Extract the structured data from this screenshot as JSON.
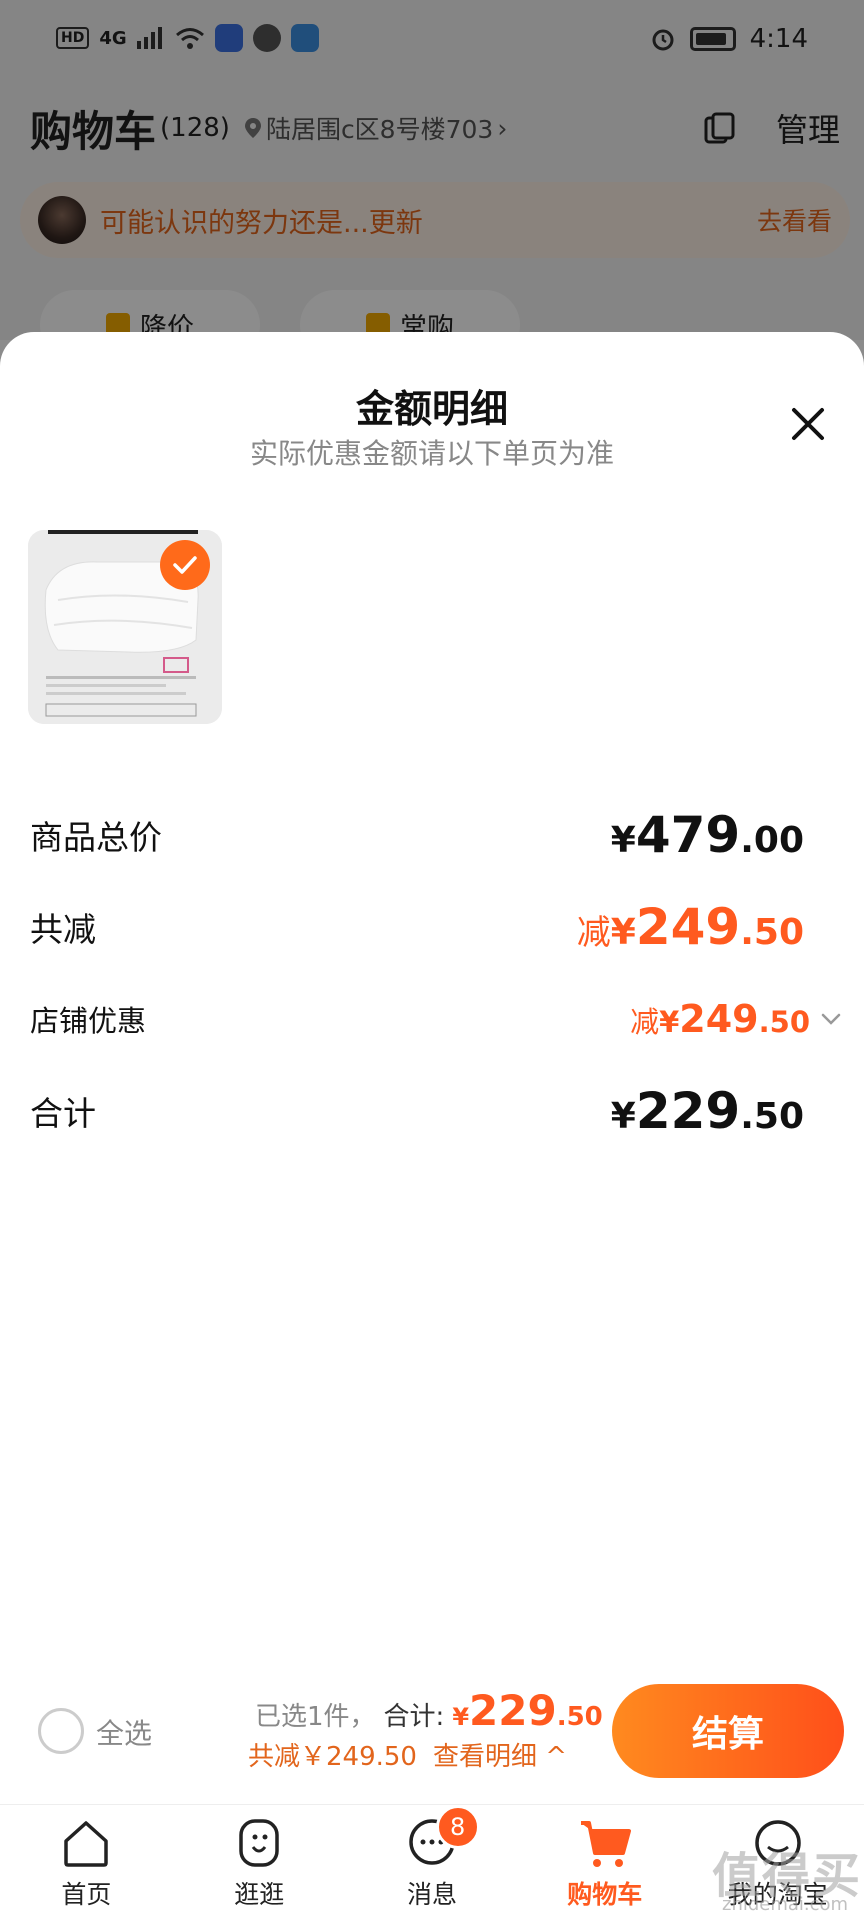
{
  "status_bar": {
    "network": "HD",
    "signal": "4G",
    "time": "4:14"
  },
  "cart_header": {
    "title": "购物车",
    "count": "(128)",
    "address": "陆居围c区8号楼703",
    "manage_label": "管理"
  },
  "notice": {
    "text": "可能认识的努力还是...更新",
    "link": "去看看"
  },
  "chips": [
    {
      "label": "降价"
    },
    {
      "label": "常购"
    }
  ],
  "sheet": {
    "title": "金额明细",
    "subtitle": "实际优惠金额请以下单页为准",
    "rows": {
      "total": {
        "label": "商品总价",
        "symbol": "¥",
        "int": "479",
        "dec": ".00"
      },
      "reduce": {
        "label": "共减",
        "prefix": "减",
        "symbol": "¥",
        "int": "249",
        "dec": ".50"
      },
      "shop_discount": {
        "label": "店铺优惠",
        "prefix": "减",
        "symbol": "¥",
        "int": "249",
        "dec": ".50"
      },
      "sum": {
        "label": "合计",
        "symbol": "¥",
        "int": "229",
        "dec": ".50"
      }
    }
  },
  "checkout": {
    "select_all": "全选",
    "selected": "已选1件，",
    "sum_label": "合计:",
    "sum_symbol": "¥",
    "sum_int": "229",
    "sum_dec": ".50",
    "reduce_text": "共减￥249.50",
    "detail_link": "查看明细 ^",
    "button": "结算"
  },
  "tabbar": {
    "items": [
      {
        "label": "首页",
        "icon": "home-icon"
      },
      {
        "label": "逛逛",
        "icon": "browse-icon"
      },
      {
        "label": "消息",
        "icon": "message-icon",
        "badge": "8"
      },
      {
        "label": "购物车",
        "icon": "cart-icon",
        "active": true
      },
      {
        "label": "我的淘宝",
        "icon": "profile-icon"
      }
    ]
  },
  "watermark": {
    "text": "值得买",
    "sub": "zhidemai.com"
  },
  "colors": {
    "accent": "#ff5a1f",
    "notice_text": "#e2651c"
  }
}
